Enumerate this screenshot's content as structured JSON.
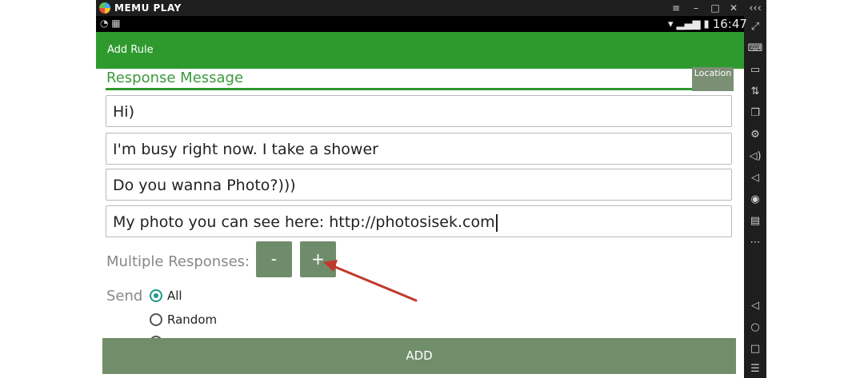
{
  "emulator": {
    "brand": "MEMU PLAY",
    "window_controls": [
      "≡",
      "–",
      "□",
      "✕",
      "‹‹‹"
    ],
    "sidebar_icons": [
      "fullscreen-icon",
      "keyboard-icon",
      "android-icon",
      "shake-icon",
      "screen-icon",
      "settings-icon",
      "volume-up-icon",
      "volume-down-icon",
      "location-icon",
      "folder-icon",
      "more-icon",
      "back-icon",
      "home-icon",
      "recent-apps-icon",
      "menu-icon"
    ]
  },
  "statusbar": {
    "left_icons": "◔ ▦",
    "wifi": "▾",
    "signal": "▂▄▆",
    "battery": "▮",
    "time": "16:47"
  },
  "appbar": {
    "title": "Add Rule"
  },
  "response": {
    "title": "Response Message",
    "location_tab": "Location",
    "messages": [
      "Hi)",
      "I'm busy right now. I take a shower",
      "Do you wanna Photo?)))",
      "My photo you can see here: http://photosisek.com"
    ]
  },
  "multiple": {
    "label": "Multiple Responses:",
    "minus": "-",
    "plus": "+"
  },
  "send": {
    "label": "Send",
    "options": [
      {
        "label": "All",
        "checked": true
      },
      {
        "label": "Random",
        "checked": false
      }
    ]
  },
  "add_button": "ADD",
  "colors": {
    "appbar": "#2e9a2e",
    "button": "#718e6b",
    "accent": "#1e9a8a",
    "arrow": "#c0392b"
  }
}
